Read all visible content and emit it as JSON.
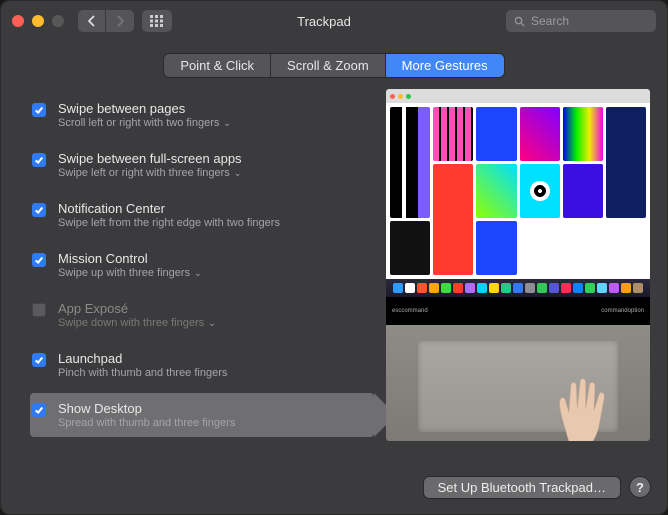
{
  "window": {
    "title": "Trackpad"
  },
  "search": {
    "placeholder": "Search"
  },
  "tabs": [
    {
      "label": "Point & Click",
      "active": false
    },
    {
      "label": "Scroll & Zoom",
      "active": false
    },
    {
      "label": "More Gestures",
      "active": true
    }
  ],
  "options": [
    {
      "title": "Swipe between pages",
      "subtitle": "Scroll left or right with two fingers",
      "checked": true,
      "dropdown": true,
      "enabled": true
    },
    {
      "title": "Swipe between full-screen apps",
      "subtitle": "Swipe left or right with three fingers",
      "checked": true,
      "dropdown": true,
      "enabled": true
    },
    {
      "title": "Notification Center",
      "subtitle": "Swipe left from the right edge with two fingers",
      "checked": true,
      "dropdown": false,
      "enabled": true
    },
    {
      "title": "Mission Control",
      "subtitle": "Swipe up with three fingers",
      "checked": true,
      "dropdown": true,
      "enabled": true
    },
    {
      "title": "App Exposé",
      "subtitle": "Swipe down with three fingers",
      "checked": false,
      "dropdown": true,
      "enabled": false
    },
    {
      "title": "Launchpad",
      "subtitle": "Pinch with thumb and three fingers",
      "checked": true,
      "dropdown": false,
      "enabled": true
    },
    {
      "title": "Show Desktop",
      "subtitle": "Spread with thumb and three fingers",
      "checked": true,
      "dropdown": false,
      "enabled": true,
      "selected": true
    }
  ],
  "touchbar": {
    "left1": "esc",
    "left2": "command",
    "right1": "command",
    "right2": "option"
  },
  "dock_colors": [
    "#2f9bff",
    "#fff",
    "#ff5230",
    "#ffa500",
    "#3fdc3f",
    "#ff3b30",
    "#a970ff",
    "#00d4ff",
    "#ffd60a",
    "#22cc88",
    "#3478f6",
    "#8e8e93",
    "#34c759",
    "#5856d6",
    "#ff2d55",
    "#0a84ff",
    "#30d158",
    "#64d2ff",
    "#bf5af2",
    "#ff9f0a",
    "#ac8e68"
  ],
  "footer": {
    "bluetooth": "Set Up Bluetooth Trackpad…",
    "help": "?"
  }
}
